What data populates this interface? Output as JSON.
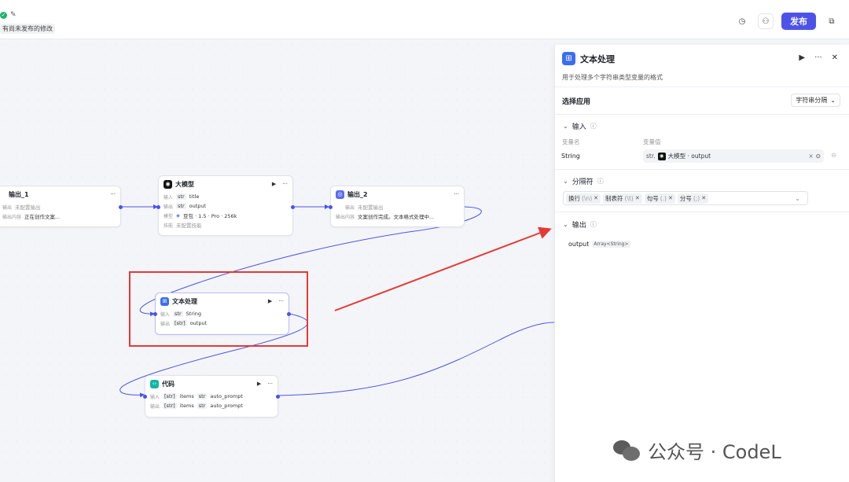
{
  "topbar": {
    "status_icon": "check-circle-icon",
    "edit_icon": "edit-icon",
    "unpublished_text": "有尚未发布的修改",
    "publish_label": "发布"
  },
  "nodes": {
    "output1": {
      "title": "输出_1",
      "rows": [
        {
          "k": "输出",
          "v": "未配置输出"
        },
        {
          "k": "输出内容",
          "v": "正在创作文案..."
        }
      ]
    },
    "llm": {
      "title": "大模型",
      "rows": [
        {
          "k": "输入",
          "tag": "str",
          "v": "title"
        },
        {
          "k": "输出",
          "tag": "str",
          "v": "output"
        },
        {
          "k": "模型",
          "v": "豆包 · 1.5 · Pro · 256k"
        },
        {
          "k": "技能",
          "v": "未配置技能"
        }
      ]
    },
    "output2": {
      "title": "输出_2",
      "rows": [
        {
          "k": "输出",
          "v": "未配置输出"
        },
        {
          "k": "输出内容",
          "v": "文案创作完成。文本格式处理中..."
        }
      ]
    },
    "text": {
      "title": "文本处理",
      "rows": [
        {
          "k": "输入",
          "tag": "str",
          "v": "String"
        },
        {
          "k": "输出",
          "tag": "[str]",
          "v": "output"
        }
      ]
    },
    "code": {
      "title": "代码",
      "rows": [
        {
          "k": "输入",
          "tag": "[str]",
          "v": "items",
          "tag2": "str",
          "v2": "auto_prompt"
        },
        {
          "k": "输出",
          "tag": "[str]",
          "v": "items",
          "tag2": "str",
          "v2": "auto_prompt"
        }
      ]
    }
  },
  "panel": {
    "title": "文本处理",
    "description": "用于处理多个字符串类型变量的格式",
    "select_app_label": "选择应用",
    "select_value": "字符串分隔",
    "input_section": "输入",
    "var_name_header": "变量名",
    "var_value_header": "变量值",
    "var_name": "String",
    "var_type": "str.",
    "var_ref": "大模型 · output",
    "separator_section": "分隔符",
    "separators": [
      {
        "label": "换行",
        "sym": "(\\n)"
      },
      {
        "label": "制表符",
        "sym": "(\\t)"
      },
      {
        "label": "句号",
        "sym": "(.)"
      },
      {
        "label": "分号",
        "sym": "(;)"
      }
    ],
    "output_section": "输出",
    "output_name": "output",
    "output_type": "Array<String>"
  },
  "watermark": "公众号 · CodeL",
  "colors": {
    "accent": "#4d53e8",
    "highlight": "#e53935",
    "success": "#1fb36b"
  }
}
